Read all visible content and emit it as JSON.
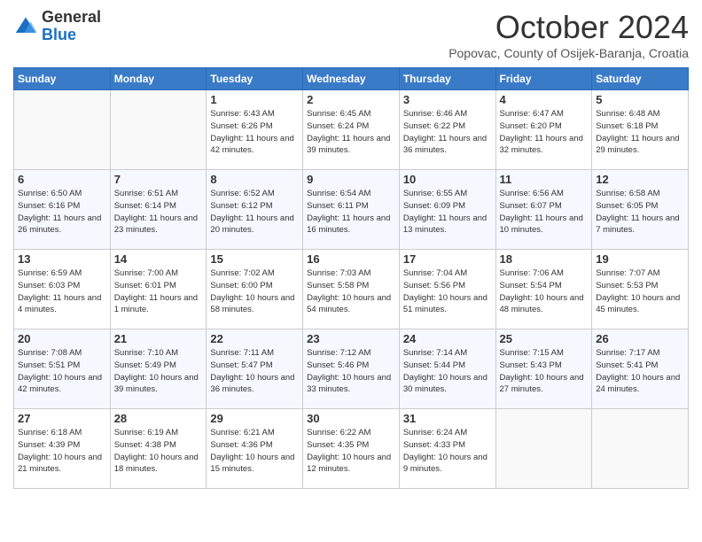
{
  "logo": {
    "general": "General",
    "blue": "Blue"
  },
  "title": "October 2024",
  "subtitle": "Popovac, County of Osijek-Baranja, Croatia",
  "weekdays": [
    "Sunday",
    "Monday",
    "Tuesday",
    "Wednesday",
    "Thursday",
    "Friday",
    "Saturday"
  ],
  "weeks": [
    [
      {
        "day": null
      },
      {
        "day": null
      },
      {
        "day": "1",
        "sunrise": "Sunrise: 6:43 AM",
        "sunset": "Sunset: 6:26 PM",
        "daylight": "Daylight: 11 hours and 42 minutes."
      },
      {
        "day": "2",
        "sunrise": "Sunrise: 6:45 AM",
        "sunset": "Sunset: 6:24 PM",
        "daylight": "Daylight: 11 hours and 39 minutes."
      },
      {
        "day": "3",
        "sunrise": "Sunrise: 6:46 AM",
        "sunset": "Sunset: 6:22 PM",
        "daylight": "Daylight: 11 hours and 36 minutes."
      },
      {
        "day": "4",
        "sunrise": "Sunrise: 6:47 AM",
        "sunset": "Sunset: 6:20 PM",
        "daylight": "Daylight: 11 hours and 32 minutes."
      },
      {
        "day": "5",
        "sunrise": "Sunrise: 6:48 AM",
        "sunset": "Sunset: 6:18 PM",
        "daylight": "Daylight: 11 hours and 29 minutes."
      }
    ],
    [
      {
        "day": "6",
        "sunrise": "Sunrise: 6:50 AM",
        "sunset": "Sunset: 6:16 PM",
        "daylight": "Daylight: 11 hours and 26 minutes."
      },
      {
        "day": "7",
        "sunrise": "Sunrise: 6:51 AM",
        "sunset": "Sunset: 6:14 PM",
        "daylight": "Daylight: 11 hours and 23 minutes."
      },
      {
        "day": "8",
        "sunrise": "Sunrise: 6:52 AM",
        "sunset": "Sunset: 6:12 PM",
        "daylight": "Daylight: 11 hours and 20 minutes."
      },
      {
        "day": "9",
        "sunrise": "Sunrise: 6:54 AM",
        "sunset": "Sunset: 6:11 PM",
        "daylight": "Daylight: 11 hours and 16 minutes."
      },
      {
        "day": "10",
        "sunrise": "Sunrise: 6:55 AM",
        "sunset": "Sunset: 6:09 PM",
        "daylight": "Daylight: 11 hours and 13 minutes."
      },
      {
        "day": "11",
        "sunrise": "Sunrise: 6:56 AM",
        "sunset": "Sunset: 6:07 PM",
        "daylight": "Daylight: 11 hours and 10 minutes."
      },
      {
        "day": "12",
        "sunrise": "Sunrise: 6:58 AM",
        "sunset": "Sunset: 6:05 PM",
        "daylight": "Daylight: 11 hours and 7 minutes."
      }
    ],
    [
      {
        "day": "13",
        "sunrise": "Sunrise: 6:59 AM",
        "sunset": "Sunset: 6:03 PM",
        "daylight": "Daylight: 11 hours and 4 minutes."
      },
      {
        "day": "14",
        "sunrise": "Sunrise: 7:00 AM",
        "sunset": "Sunset: 6:01 PM",
        "daylight": "Daylight: 11 hours and 1 minute."
      },
      {
        "day": "15",
        "sunrise": "Sunrise: 7:02 AM",
        "sunset": "Sunset: 6:00 PM",
        "daylight": "Daylight: 10 hours and 58 minutes."
      },
      {
        "day": "16",
        "sunrise": "Sunrise: 7:03 AM",
        "sunset": "Sunset: 5:58 PM",
        "daylight": "Daylight: 10 hours and 54 minutes."
      },
      {
        "day": "17",
        "sunrise": "Sunrise: 7:04 AM",
        "sunset": "Sunset: 5:56 PM",
        "daylight": "Daylight: 10 hours and 51 minutes."
      },
      {
        "day": "18",
        "sunrise": "Sunrise: 7:06 AM",
        "sunset": "Sunset: 5:54 PM",
        "daylight": "Daylight: 10 hours and 48 minutes."
      },
      {
        "day": "19",
        "sunrise": "Sunrise: 7:07 AM",
        "sunset": "Sunset: 5:53 PM",
        "daylight": "Daylight: 10 hours and 45 minutes."
      }
    ],
    [
      {
        "day": "20",
        "sunrise": "Sunrise: 7:08 AM",
        "sunset": "Sunset: 5:51 PM",
        "daylight": "Daylight: 10 hours and 42 minutes."
      },
      {
        "day": "21",
        "sunrise": "Sunrise: 7:10 AM",
        "sunset": "Sunset: 5:49 PM",
        "daylight": "Daylight: 10 hours and 39 minutes."
      },
      {
        "day": "22",
        "sunrise": "Sunrise: 7:11 AM",
        "sunset": "Sunset: 5:47 PM",
        "daylight": "Daylight: 10 hours and 36 minutes."
      },
      {
        "day": "23",
        "sunrise": "Sunrise: 7:12 AM",
        "sunset": "Sunset: 5:46 PM",
        "daylight": "Daylight: 10 hours and 33 minutes."
      },
      {
        "day": "24",
        "sunrise": "Sunrise: 7:14 AM",
        "sunset": "Sunset: 5:44 PM",
        "daylight": "Daylight: 10 hours and 30 minutes."
      },
      {
        "day": "25",
        "sunrise": "Sunrise: 7:15 AM",
        "sunset": "Sunset: 5:43 PM",
        "daylight": "Daylight: 10 hours and 27 minutes."
      },
      {
        "day": "26",
        "sunrise": "Sunrise: 7:17 AM",
        "sunset": "Sunset: 5:41 PM",
        "daylight": "Daylight: 10 hours and 24 minutes."
      }
    ],
    [
      {
        "day": "27",
        "sunrise": "Sunrise: 6:18 AM",
        "sunset": "Sunset: 4:39 PM",
        "daylight": "Daylight: 10 hours and 21 minutes."
      },
      {
        "day": "28",
        "sunrise": "Sunrise: 6:19 AM",
        "sunset": "Sunset: 4:38 PM",
        "daylight": "Daylight: 10 hours and 18 minutes."
      },
      {
        "day": "29",
        "sunrise": "Sunrise: 6:21 AM",
        "sunset": "Sunset: 4:36 PM",
        "daylight": "Daylight: 10 hours and 15 minutes."
      },
      {
        "day": "30",
        "sunrise": "Sunrise: 6:22 AM",
        "sunset": "Sunset: 4:35 PM",
        "daylight": "Daylight: 10 hours and 12 minutes."
      },
      {
        "day": "31",
        "sunrise": "Sunrise: 6:24 AM",
        "sunset": "Sunset: 4:33 PM",
        "daylight": "Daylight: 10 hours and 9 minutes."
      },
      {
        "day": null
      },
      {
        "day": null
      }
    ]
  ]
}
